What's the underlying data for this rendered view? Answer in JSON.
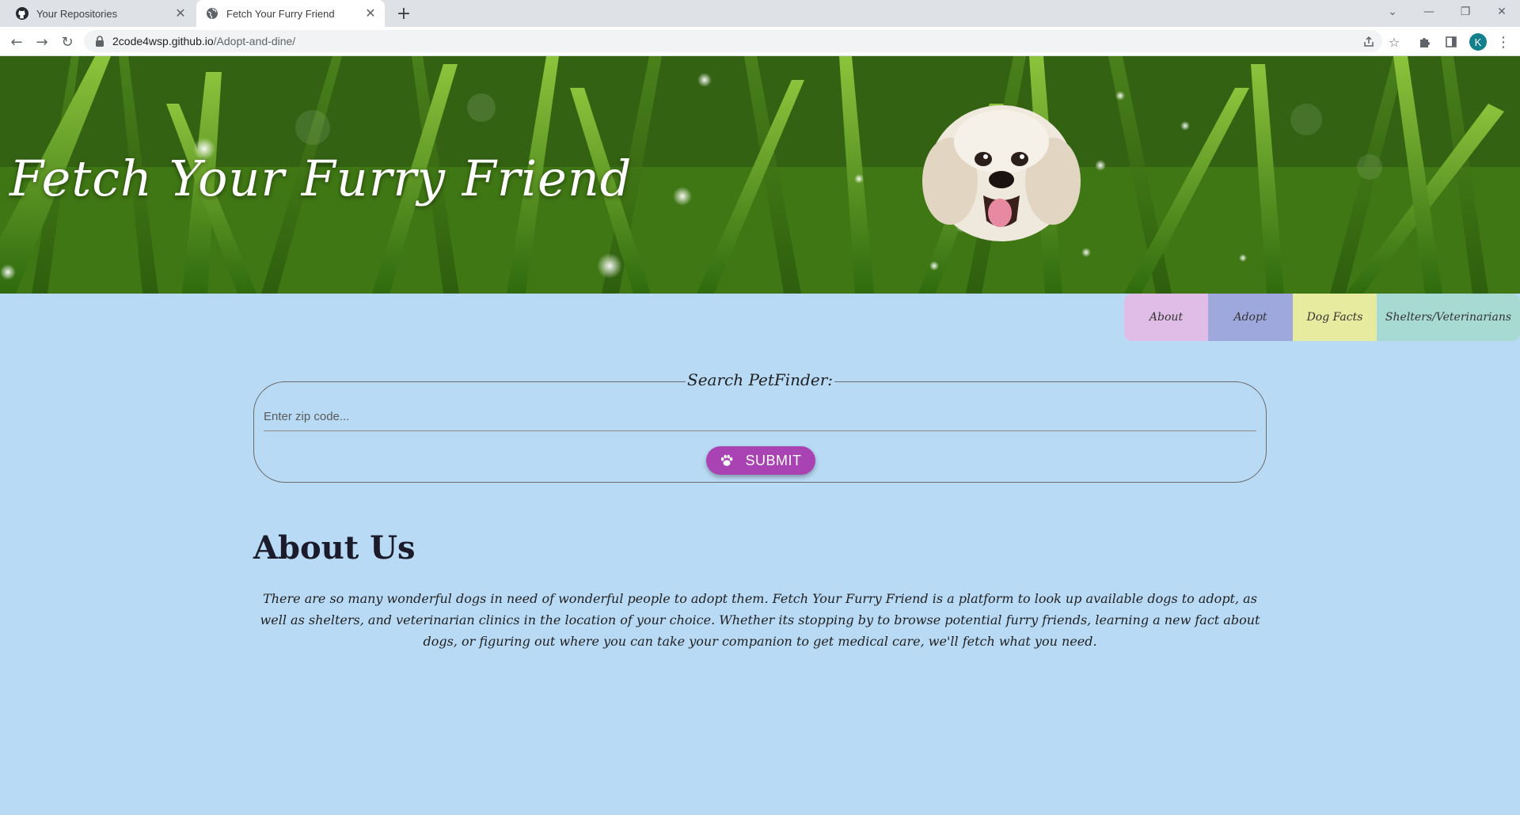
{
  "browser": {
    "tabs": [
      {
        "label": "Your Repositories",
        "icon": "github-icon",
        "active": false
      },
      {
        "label": "Fetch Your Furry Friend",
        "icon": "globe-icon",
        "active": true
      }
    ],
    "url_host": "2code4wsp.github.io",
    "url_path": "/Adopt-and-dine/",
    "profile_initial": "K"
  },
  "hero": {
    "title": "Fetch Your Furry Friend"
  },
  "nav": {
    "about": "About",
    "adopt": "Adopt",
    "dog_facts": "Dog Facts",
    "shelters": "Shelters/Veterinarians"
  },
  "search": {
    "legend": "Search PetFinder:",
    "zip_placeholder": "Enter zip code...",
    "submit_label": "SUBMIT"
  },
  "about": {
    "title": "About Us",
    "text": "There are so many wonderful dogs in need of wonderful people to adopt them. Fetch Your Furry Friend is a platform to look up available dogs to adopt, as well as shelters, and veterinarian clinics in the location of your choice. Whether its stopping by to browse potential furry friends, learning a new fact about dogs, or figuring out where you can take your companion to get medical care, we'll fetch what you need."
  },
  "colors": {
    "page_bg": "#b8daf5",
    "nav_about": "#e0bde6",
    "nav_adopt": "#9fa8dd",
    "nav_dog_facts": "#e6eb9f",
    "nav_shelters": "#a8dad4",
    "submit_bg": "#a942b3"
  }
}
